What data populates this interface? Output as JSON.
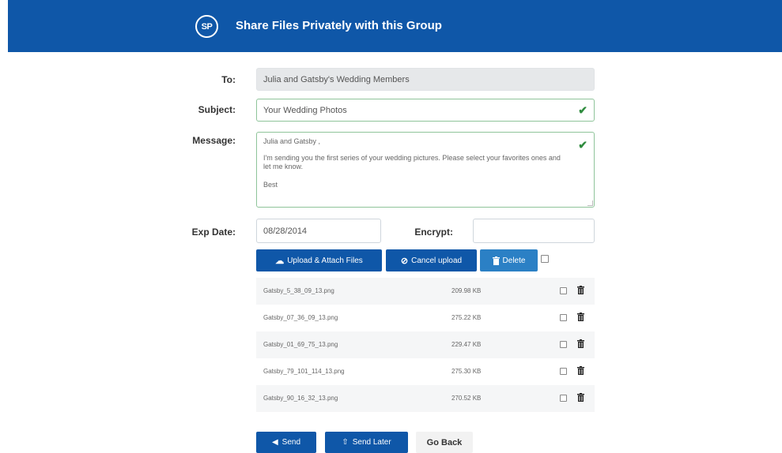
{
  "header": {
    "logo_text": "SP",
    "title": "Share Files Privately with this Group",
    "color": "#0f57a8"
  },
  "form": {
    "to": {
      "label": "To:",
      "value": "Julia and Gatsby's Wedding Members"
    },
    "subject": {
      "label": "Subject:",
      "value": "Your Wedding Photos",
      "valid_icon": "check-icon"
    },
    "message": {
      "label": "Message:",
      "greeting": "Julia and Gatsby ,",
      "body": "I'm sending you the first series of your wedding pictures. Please select your favorites ones and let me know.",
      "closing": "Best"
    },
    "exp_date": {
      "label": "Exp Date:",
      "value": "08/28/2014"
    },
    "encrypt": {
      "label": "Encrypt:",
      "value": ""
    }
  },
  "file_actions": {
    "upload_label": "Upload & Attach Files",
    "cancel_label": "Cancel upload",
    "delete_label": "Delete"
  },
  "files": [
    {
      "name": "Gatsby_5_38_09_13.png",
      "size": "209.98 KB"
    },
    {
      "name": "Gatsby_07_36_09_13.png",
      "size": "275.22 KB"
    },
    {
      "name": "Gatsby_01_69_75_13.png",
      "size": "229.47 KB"
    },
    {
      "name": "Gatsby_79_101_114_13.png",
      "size": "275.30 KB"
    },
    {
      "name": "Gatsby_90_16_32_13.png",
      "size": "270.52 KB"
    }
  ],
  "footer": {
    "send_label": "Send",
    "send_later_label": "Send Later",
    "go_back_label": "Go Back"
  }
}
